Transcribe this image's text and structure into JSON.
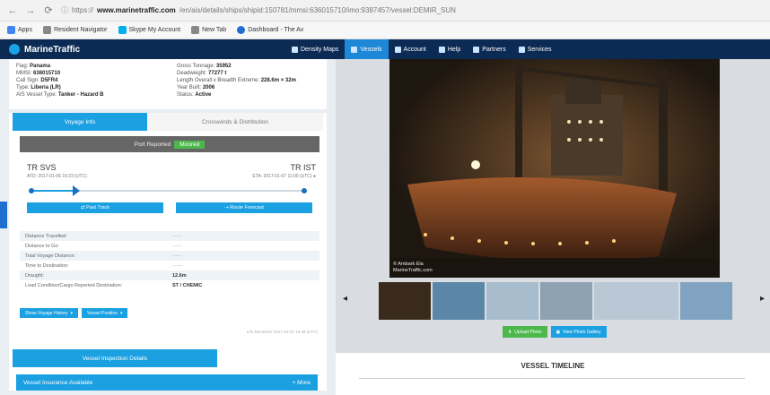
{
  "browser": {
    "url_prefix": "https://",
    "url_domain": "www.marinetraffic.com",
    "url_path": "/en/ais/details/ships/shipid:150781/mmsi:636015710/imo:9387457/vessel:DEMIR_SUN",
    "bookmarks": [
      {
        "label": "Apps",
        "icon": "apps-icon",
        "color": "#4285f4"
      },
      {
        "label": "Resident Navigator",
        "icon": "page-icon",
        "color": "#888888"
      },
      {
        "label": "Skype My Account",
        "icon": "skype-icon",
        "color": "#00aff0"
      },
      {
        "label": "New Tab",
        "icon": "page-icon",
        "color": "#888888"
      },
      {
        "label": "Dashboard - The Av",
        "icon": "dashboard-icon",
        "color": "#1f6fd0"
      }
    ]
  },
  "app": {
    "logo": "MarineTraffic",
    "nav": [
      {
        "label": "Density Maps",
        "active": false
      },
      {
        "label": "Vessels",
        "active": true
      },
      {
        "label": "Account",
        "active": false
      },
      {
        "label": "Help",
        "active": false
      },
      {
        "label": "Partners",
        "active": false
      },
      {
        "label": "Services",
        "active": false
      }
    ]
  },
  "info": {
    "left": [
      {
        "k": "Flag:",
        "v": "Panama"
      },
      {
        "k": "MMSI:",
        "v": "636015710"
      },
      {
        "k": "Call Sign:",
        "v": "D5FR4"
      },
      {
        "k": "Type:",
        "v": "Liberia (LR)"
      },
      {
        "k": "AIS Vessel Type:",
        "v": "Tanker - Hazard B"
      }
    ],
    "right": [
      {
        "k": "Gross Tonnage:",
        "v": "35952"
      },
      {
        "k": "Deadweight:",
        "v": "77277 t"
      },
      {
        "k": "Length Overall x Breadth Extreme:",
        "v": "228.6m × 32m"
      },
      {
        "k": "Year Built:",
        "v": "2006"
      },
      {
        "k": "Status:",
        "v": "Active"
      }
    ]
  },
  "voyage": {
    "tab1": "Voyage Info",
    "tab2": "Crosswinds & Distribution",
    "status_prefix": "Port Reported",
    "status_badge": "Moored",
    "from_code": "TR SVS",
    "from_sub": "ATD: 2017-01-06 10:23 (UTC)",
    "to_code": "TR IST",
    "to_sub": "ETA: 2017-01-07 11:00 (UTC) ●",
    "progress": 0.16,
    "btn_left": "Past Track",
    "btn_right": "Route Forecast",
    "rows": [
      {
        "k": "Distance Travelled:",
        "v": "------",
        "strong": false
      },
      {
        "k": "Distance to Go:",
        "v": "------",
        "strong": false
      },
      {
        "k": "Total Voyage Distance:",
        "v": "------",
        "strong": false
      },
      {
        "k": "Time to Destination:",
        "v": "------",
        "strong": false
      },
      {
        "k": "Draught:",
        "v": "12.6m",
        "strong": true
      },
      {
        "k": "Load Condition/Cargo Reported Destination:",
        "v": "ST / CHEMIC",
        "strong": true
      }
    ],
    "mini_buttons": [
      "Show Voyage History",
      "Vessel Position"
    ],
    "note": "Info Received: 2017-01-07 10:48 (UTC)"
  },
  "banners": {
    "primary": "Vessel Inspection Details",
    "secondary": "Vessel Insurance Available",
    "secondary_right": "+ More"
  },
  "photos": {
    "credit_line1": "© Ambark Ela",
    "credit_line2": "MarineTraffic.com",
    "thumb_colors": [
      "#3a2a1c",
      "#5a86a8",
      "#a7bccc",
      "#8ea2b2",
      "#b9c8d4",
      "#7fa3c0"
    ],
    "btn_upload": "Upload Photo",
    "btn_gallery": "View Photo Gallery"
  },
  "timeline": {
    "title": "VESSEL TIMELINE"
  }
}
